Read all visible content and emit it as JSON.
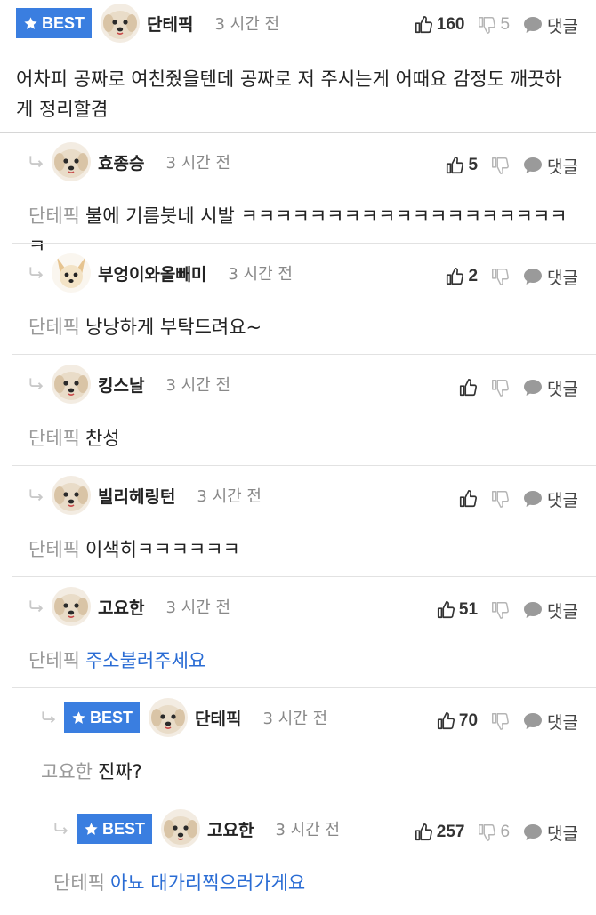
{
  "icons": {
    "like": "thumbs-up-icon",
    "dislike": "thumbs-down-icon",
    "reply": "speech-bubble-icon",
    "nested": "reply-arrow-icon",
    "best": "star-icon"
  },
  "colors": {
    "best_badge": "#3a7ee0",
    "link_text": "#2a6cd4",
    "mention": "#999999"
  },
  "comments": [
    {
      "badge": "BEST",
      "nickname": "단테픽",
      "time": "3 시간 전",
      "likes": "160",
      "dislikes": "5",
      "reply_label": "댓글",
      "text": "어차피 공짜로 여친줬을텐데 공짜로 저 주시는게 어때요 감정도 깨끗하게 정리할겸"
    },
    {
      "nickname": "효종승",
      "time": "3 시간 전",
      "likes": "5",
      "dislikes": "",
      "reply_label": "댓글",
      "mention": "단테픽",
      "text": "불에 기름붓네 시발 ㅋㅋㅋㅋㅋㅋㅋㅋㅋㅋㅋㅋㅋㅋㅋㅋㅋㅋㅋㅋ"
    },
    {
      "nickname": "부엉이와올빼미",
      "time": "3 시간 전",
      "likes": "2",
      "dislikes": "",
      "reply_label": "댓글",
      "mention": "단테픽",
      "text": "낭낭하게 부탁드려요~"
    },
    {
      "nickname": "킹스날",
      "time": "3 시간 전",
      "likes": "",
      "dislikes": "",
      "reply_label": "댓글",
      "mention": "단테픽",
      "text": "찬성"
    },
    {
      "nickname": "빌리헤링턴",
      "time": "3 시간 전",
      "likes": "",
      "dislikes": "",
      "reply_label": "댓글",
      "mention": "단테픽",
      "text": "이색히ㅋㅋㅋㅋㅋㅋ"
    },
    {
      "nickname": "고요한",
      "time": "3 시간 전",
      "likes": "51",
      "dislikes": "",
      "reply_label": "댓글",
      "mention": "단테픽",
      "text": "주소불러주세요"
    },
    {
      "badge": "BEST",
      "nickname": "단테픽",
      "time": "3 시간 전",
      "likes": "70",
      "dislikes": "",
      "reply_label": "댓글",
      "mention": "고요한",
      "text": "진짜?"
    },
    {
      "badge": "BEST",
      "nickname": "고요한",
      "time": "3 시간 전",
      "likes": "257",
      "dislikes": "6",
      "reply_label": "댓글",
      "mention": "단테픽",
      "text": "아뇨 대가리찍으러가게요"
    }
  ]
}
